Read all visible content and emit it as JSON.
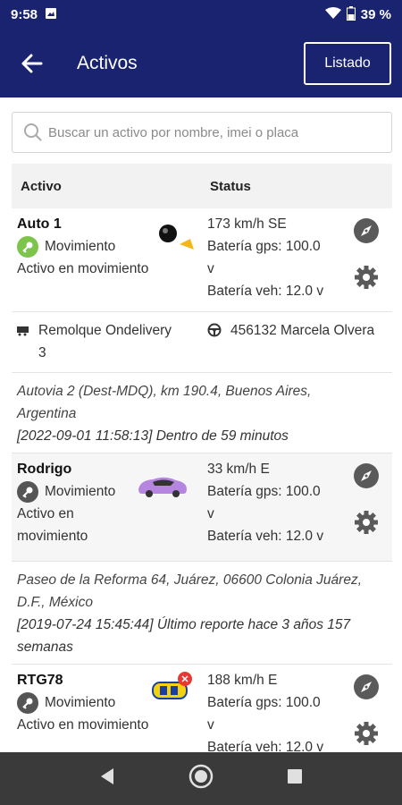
{
  "status_bar": {
    "time": "9:58",
    "battery": "39 %"
  },
  "app_bar": {
    "title": "Activos",
    "listado_label": "Listado"
  },
  "search": {
    "placeholder": "Buscar un activo por nombre, imei o placa"
  },
  "table": {
    "col_activo": "Activo",
    "col_status": "Status"
  },
  "assets": [
    {
      "name": "Auto 1",
      "state": "Movimiento",
      "state_color": "#7cc44a",
      "description": "Activo en movimiento",
      "speed": "173 km/h SE",
      "battery_gps_a": "Batería gps: 100.0",
      "battery_gps_b": "v",
      "battery_veh": "Batería veh: 12.0 v",
      "trailer": "Remolque Ondelivery",
      "trailer_b": "3",
      "driver": "456132 Marcela Olvera",
      "address_a": "Autovia 2 (Dest-MDQ), km 190.4, Buenos Aires,",
      "address_b": "Argentina",
      "report": "[2022-09-01 11:58:13] Dentro de 59 minutos"
    },
    {
      "name": "Rodrigo",
      "state": "Movimiento",
      "state_color": "#555555",
      "description_a": "Activo en",
      "description_b": "movimiento",
      "speed": "33 km/h E",
      "battery_gps_a": "Batería gps: 100.0",
      "battery_gps_b": "v",
      "battery_veh": "Batería veh: 12.0 v",
      "address_a": "Paseo de la Reforma 64, Juárez, 06600 Colonia Juárez,",
      "address_b": "D.F., México",
      "report_a": "[2019-07-24 15:45:44] Último reporte hace 3 años 157",
      "report_b": "semanas"
    },
    {
      "name": "RTG78",
      "state": "Movimiento",
      "state_color": "#555555",
      "description": "Activo en movimiento",
      "speed": "188 km/h E",
      "battery_gps_a": "Batería gps: 100.0",
      "battery_gps_b": "v",
      "battery_veh": "Batería veh: 12.0 v"
    }
  ]
}
